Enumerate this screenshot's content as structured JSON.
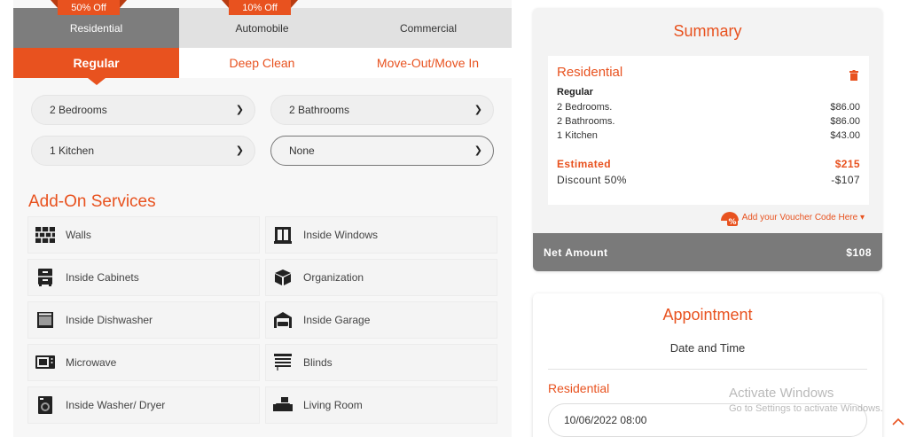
{
  "property_tabs": [
    {
      "label": "Residential",
      "ribbon": "50% Off",
      "active": true
    },
    {
      "label": "Automobile",
      "ribbon": "10% Off",
      "active": false
    },
    {
      "label": "Commercial",
      "ribbon": "",
      "active": false
    }
  ],
  "cleaning_tabs": [
    {
      "label": "Regular",
      "active": true
    },
    {
      "label": "Deep Clean",
      "active": false
    },
    {
      "label": "Move-Out/Move In",
      "active": false
    }
  ],
  "selects": {
    "bedrooms": "2 Bedrooms",
    "bathrooms": "2 Bathrooms",
    "kitchen": "1 Kitchen",
    "extra": "None"
  },
  "addons_title": "Add-On Services",
  "addons": [
    {
      "label": "Walls",
      "icon": "brick-wall-icon"
    },
    {
      "label": "Inside Windows",
      "icon": "window-icon"
    },
    {
      "label": "Inside Cabinets",
      "icon": "cabinet-icon"
    },
    {
      "label": "Organization",
      "icon": "box-icon"
    },
    {
      "label": "Inside Dishwasher",
      "icon": "dishwasher-icon"
    },
    {
      "label": "Inside Garage",
      "icon": "garage-icon"
    },
    {
      "label": "Microwave",
      "icon": "microwave-icon"
    },
    {
      "label": "Blinds",
      "icon": "blinds-icon"
    },
    {
      "label": "Inside Washer/ Dryer",
      "icon": "washer-icon"
    },
    {
      "label": "Living Room",
      "icon": "sofa-icon"
    }
  ],
  "summary": {
    "title": "Summary",
    "card_title": "Residential",
    "subtitle": "Regular",
    "lines": [
      {
        "label": "2 Bedrooms.",
        "amount": "$86.00"
      },
      {
        "label": "2 Bathrooms.",
        "amount": "$86.00"
      },
      {
        "label": "1 Kitchen",
        "amount": "$43.00"
      }
    ],
    "estimated_label": "Estimated",
    "estimated_value": "$215",
    "discount_label": "Discount 50%",
    "discount_value": "-$107",
    "voucher_link": "Add your Voucher Code Here ▾",
    "net_label": "Net Amount",
    "net_value": "$108"
  },
  "appointment": {
    "title": "Appointment",
    "subtitle": "Date and Time",
    "label": "Residential",
    "date_value": "10/06/2022 08:00"
  },
  "watermark": {
    "line1": "Activate Windows",
    "line2": "Go to Settings to activate Windows."
  },
  "colors": {
    "accent": "#e8521f",
    "gray_tab": "#7d7d7d",
    "net_bar": "#7a7a7a"
  }
}
